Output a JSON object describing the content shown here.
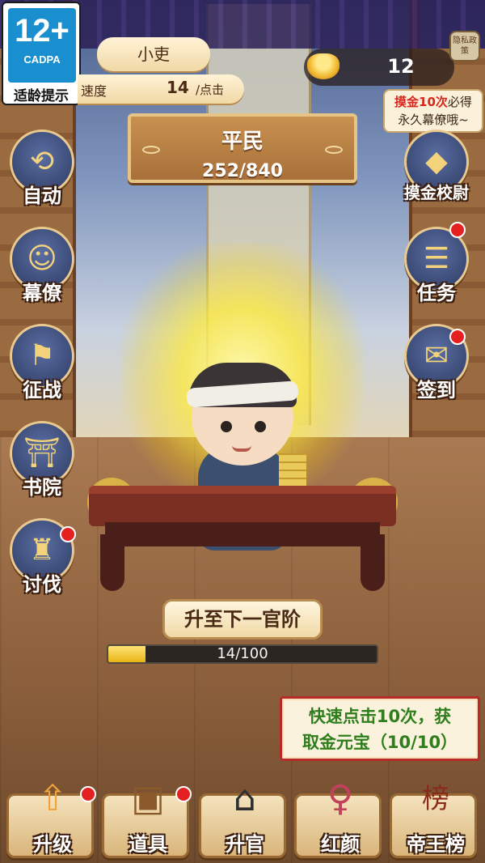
{
  "age_rating": {
    "number": "12+",
    "org": "CADPA",
    "caption": "适龄提示"
  },
  "header": {
    "rank_title": "小吏",
    "speed_label": "速度",
    "speed_value": "14",
    "speed_unit": "/点击",
    "ingot_count": "12",
    "privacy_label": "隐私政策",
    "promo_red": "摸金10次",
    "promo_rest_1": "必得",
    "promo_rest_2": "永久幕僚哦~"
  },
  "rank_plaque": {
    "name": "平民",
    "progress": "252/840"
  },
  "left_buttons": [
    {
      "label": "自动",
      "icon": "cloud-swirl-icon",
      "glyph": "⟲",
      "badge": false
    },
    {
      "label": "幕僚",
      "icon": "advisor-icon",
      "glyph": "☺",
      "badge": false
    },
    {
      "label": "征战",
      "icon": "war-flag-icon",
      "glyph": "⚑",
      "badge": false
    },
    {
      "label": "书院",
      "icon": "academy-icon",
      "glyph": "⛩",
      "badge": false
    },
    {
      "label": "讨伐",
      "icon": "fortress-icon",
      "glyph": "♜",
      "badge": true
    }
  ],
  "right_buttons": [
    {
      "label": "摸金校尉",
      "icon": "crystal-icon",
      "glyph": "◆",
      "badge": false
    },
    {
      "label": "任务",
      "icon": "scroll-task-icon",
      "glyph": "☰",
      "badge": true
    },
    {
      "label": "签到",
      "icon": "checkin-book-icon",
      "glyph": "✉",
      "badge": true
    }
  ],
  "upgrade": {
    "button_label": "升至下一官阶",
    "progress_text": "14/100",
    "progress_fraction": 0.14
  },
  "quest": {
    "line1": "快速点击10次，获",
    "line2": "取金元宝（10/10）"
  },
  "bottom_nav": [
    {
      "label": "升级",
      "icon": "upgrade-arrow-icon",
      "glyph": "⇧",
      "badge": true
    },
    {
      "label": "道具",
      "icon": "treasure-chest-icon",
      "glyph": "▣",
      "badge": true
    },
    {
      "label": "升官",
      "icon": "official-hat-icon",
      "glyph": "⌂",
      "badge": false
    },
    {
      "label": "红颜",
      "icon": "lady-portrait-icon",
      "glyph": "♀",
      "badge": false
    },
    {
      "label": "帝王榜",
      "icon": "ranking-scroll-icon",
      "glyph": "榜",
      "badge": false
    }
  ],
  "colors": {
    "accent_gold": "#f2d27a",
    "badge_red": "#e42020",
    "quest_green": "#2f7d1c"
  }
}
